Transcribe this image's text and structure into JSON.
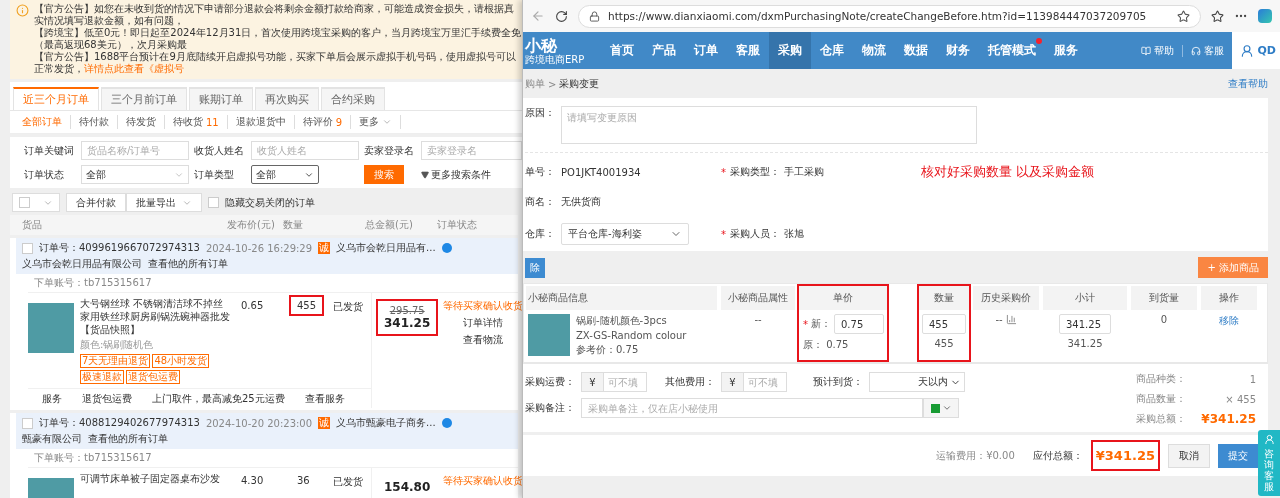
{
  "background_page": {
    "notices": [
      {
        "text": "【官方公告】如您在未收到货的情况下申请部分退款会将剩余金额打款给商家，可能造成资金损失，请根据真实情况填写退款金额，如有问题，"
      },
      {
        "text": "【跨境宝】低至0元！即日起至2024年12月31日，首次使用跨境宝采购的客户，当月跨境宝万里汇手续费全免（最高返现68美元），次月采购最"
      },
      {
        "text": "【官方公告】1688平台预计在9月底陆续开启虚拟号功能，买家下单后会展示虚拟手机号码，使用虚拟号可以正常发货，",
        "link": "详情点此查看《虚拟号"
      }
    ],
    "tabs": [
      {
        "label": "近三个月订单",
        "selected": true
      },
      {
        "label": "三个月前订单",
        "selected": false
      },
      {
        "label": "账期订单",
        "selected": false
      },
      {
        "label": "再次购买",
        "selected": false
      },
      {
        "label": "合约采购",
        "selected": false
      }
    ],
    "status_filters": [
      {
        "label": "全部订单",
        "selected": true,
        "kind": "plain"
      },
      {
        "label": "待付款",
        "selected": false,
        "kind": "plain"
      },
      {
        "label": "待发货",
        "selected": false,
        "kind": "plain"
      },
      {
        "label": "待收货",
        "count": "11",
        "selected": false,
        "kind": "plain"
      },
      {
        "label": "退款退货中",
        "selected": false,
        "kind": "plain"
      },
      {
        "label": "待评价",
        "count": "9",
        "selected": false,
        "kind": "plain"
      },
      {
        "label": "更多",
        "selected": false,
        "kind": "dropdown"
      }
    ],
    "search_form": {
      "fields": [
        {
          "label": "订单关键词",
          "placeholder": "货品名称/订单号",
          "kind": "input"
        },
        {
          "label": "收货人姓名",
          "placeholder": "收货人姓名",
          "kind": "input"
        },
        {
          "label": "卖家登录名",
          "placeholder": "卖家登录名",
          "kind": "input"
        },
        {
          "label": "订单状态",
          "value": "全部",
          "kind": "select"
        },
        {
          "label": "订单类型",
          "value": "全部",
          "kind": "native"
        }
      ],
      "search_button": "搜索",
      "more_conditions": "更多搜索条件"
    },
    "toolbar": {
      "select_all": {
        "checked": false
      },
      "merge_button": "合并付款",
      "export_button": "批量导出",
      "hide_closed": {
        "label": "隐藏交易关闭的订单",
        "checked": false
      }
    },
    "columns": [
      "货品",
      "发布价(元)",
      "数量",
      "总金额(元)",
      "订单状态"
    ],
    "orders": [
      {
        "checked": false,
        "order_label": "订单号：",
        "order_no": "4099619667072974313",
        "time": "2024-10-26 16:29:29",
        "shop_badge": "诚",
        "shop": "义乌市会乾日用品有...",
        "company": "义乌市会乾日用品有限公司",
        "view_all": "查看他的所有订单",
        "account_label": "下单账号：",
        "account": "tb715315617",
        "title": "大号钢丝球 不锈钢清洁球不掉丝家用铁丝球厨房刷锅洗碗神器批发",
        "snapshot": "【货品快照】",
        "attr": "颜色:锅刷随机色",
        "tags": [
          "7天无理由退货",
          "48小时发货",
          "极速退款",
          "退货包运费"
        ],
        "price": "0.65",
        "quantity": "455",
        "quantity_highlighted": true,
        "ship_status": "已发货",
        "original_total": "295.75",
        "total": "341.25",
        "total_highlighted": true,
        "status": "等待买家确认收货",
        "actions": [
          "订单详情",
          "查看物流"
        ],
        "service": {
          "label": "服务",
          "name": "退货包运费",
          "desc": "上门取件，最高减免25元运费",
          "link": "查看服务"
        }
      },
      {
        "checked": false,
        "order_label": "订单号：",
        "order_no": "4088129402677974313",
        "time": "2024-10-20 20:23:00",
        "shop_badge": "诚",
        "shop": "义乌市甄豪电子商务...",
        "company": "甄豪有限公司",
        "view_all": "查看他的所有订单",
        "account_label": "下单账号：",
        "account": "tb715315617",
        "title": "可调节床单被子固定器桌布沙发",
        "price": "4.30",
        "quantity": "36",
        "quantity_highlighted": false,
        "ship_status": "已发货",
        "total": "154.80",
        "total_highlighted": false,
        "status": "等待买家确认收货"
      }
    ]
  },
  "browser": {
    "url": "https://www.dianxiaomi.com/dxmPurchasingNote/createChangeBefore.htm?id=113984447037209705"
  },
  "app": {
    "logo": "小秘",
    "logo_subtitle": "跨境电商ERP",
    "nav": [
      {
        "label": "首页",
        "selected": false,
        "badge": false
      },
      {
        "label": "产品",
        "selected": false,
        "badge": false
      },
      {
        "label": "订单",
        "selected": false,
        "badge": false
      },
      {
        "label": "客服",
        "selected": false,
        "badge": false
      },
      {
        "label": "采购",
        "selected": true,
        "badge": false
      },
      {
        "label": "仓库",
        "selected": false,
        "badge": false
      },
      {
        "label": "物流",
        "selected": false,
        "badge": false
      },
      {
        "label": "数据",
        "selected": false,
        "badge": false
      },
      {
        "label": "财务",
        "selected": false,
        "badge": false
      },
      {
        "label": "托管模式",
        "selected": false,
        "badge": true
      },
      {
        "label": "服务",
        "selected": false,
        "badge": false
      }
    ],
    "help": "帮助",
    "service": "客服",
    "user": "QD"
  },
  "breadcrumb": {
    "parent": "购单",
    "separator": ">",
    "current": "采购变更",
    "help_link": "查看帮助"
  },
  "form": {
    "reason": {
      "label": "原因：",
      "placeholder": "请填写变更原因"
    },
    "order_no": {
      "label": "单号：",
      "value": "PO1JKT4001934"
    },
    "purchase_type": {
      "mark": "*",
      "label": "采购类型：",
      "value": "手工采购"
    },
    "annotation": "核对好采购数量 以及采购金额",
    "supplier": {
      "label": "商名：",
      "value": "无供货商"
    },
    "warehouse": {
      "label": "仓库：",
      "value": "平台仓库-海利姿"
    },
    "buyer": {
      "mark": "*",
      "label": "采购人员：",
      "value": "张旭"
    }
  },
  "actions": {
    "delete": "除",
    "add": "+ 添加商品"
  },
  "items_table": {
    "columns": [
      {
        "label": "小秘商品信息",
        "kind": "info",
        "highlighted": false
      },
      {
        "label": "小秘商品属性",
        "kind": "attr",
        "highlighted": false
      },
      {
        "label": "单价",
        "kind": "price",
        "highlighted": true
      },
      {
        "label": "数量",
        "kind": "qty",
        "highlighted": true
      },
      {
        "label": "历史采购价",
        "kind": "history",
        "highlighted": false
      },
      {
        "label": "小计",
        "kind": "subtotal",
        "highlighted": false
      },
      {
        "label": "到货量",
        "kind": "received",
        "highlighted": false
      },
      {
        "label": "操作",
        "kind": "action",
        "highlighted": false
      }
    ],
    "rows": [
      {
        "name": "锅刷-随机颜色-3pcs",
        "sku": "ZX-GS-Random colour",
        "ref_label": "参考价：",
        "ref_price": "0.75",
        "attr": "--",
        "new_mark": "*",
        "new_label": "新：",
        "new_price": "0.75",
        "orig_label": "原：",
        "orig_price": "0.75",
        "quantity": "455",
        "orig_quantity": "455",
        "history": "--",
        "subtotal": "341.25",
        "orig_subtotal": "341.25",
        "received": "0",
        "action": "移除"
      }
    ]
  },
  "costs": {
    "freight": {
      "label": "采购运费：",
      "currency": "¥",
      "placeholder": "可不填"
    },
    "other": {
      "label": "其他费用：",
      "currency": "¥",
      "placeholder": "可不填"
    },
    "eta": {
      "label": "预计到货：",
      "value": "天以内"
    },
    "remark": {
      "label": "采购备注：",
      "placeholder": "采购单备注，仅在店小秘使用",
      "color": "#179b33"
    }
  },
  "summary": [
    {
      "label": "商品种类：",
      "value": "1",
      "kind": "plain"
    },
    {
      "label": "商品数量：",
      "value": "× 455",
      "kind": "plain"
    },
    {
      "label": "采购总额：",
      "value": "¥341.25",
      "kind": "total"
    }
  ],
  "footer": {
    "shipping_label": "运输费用：",
    "shipping": "¥0.00",
    "payable_label": "应付总额：",
    "payable": "¥341.25",
    "payable_highlighted": true,
    "cancel": "取消",
    "submit": "提交"
  },
  "chat_widget": "咨询客服"
}
